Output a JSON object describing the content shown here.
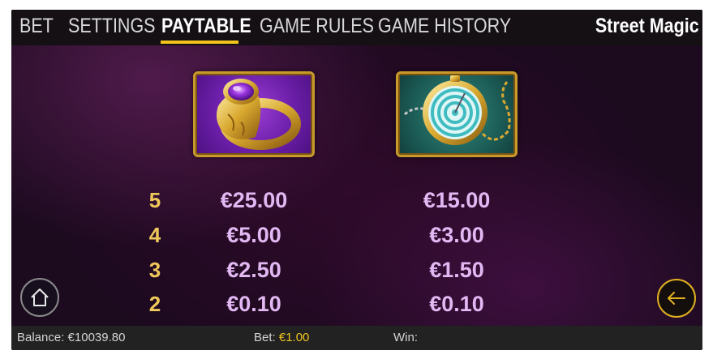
{
  "nav": {
    "tabs": [
      {
        "label": "BET",
        "active": false
      },
      {
        "label": "SETTINGS",
        "active": false
      },
      {
        "label": "PAYTABLE",
        "active": true
      },
      {
        "label": "GAME RULES",
        "active": false
      },
      {
        "label": "GAME HISTORY",
        "active": false
      }
    ],
    "game_title": "Street Magic",
    "accent_color": "#f2c41c"
  },
  "paytable": {
    "symbols": [
      {
        "name": "ring-symbol",
        "icon": "amethyst-ring"
      },
      {
        "name": "watch-symbol",
        "icon": "pocket-watch"
      }
    ],
    "rows": [
      {
        "count": "5",
        "values": [
          "€25.00",
          "€15.00"
        ]
      },
      {
        "count": "4",
        "values": [
          "€5.00",
          "€3.00"
        ]
      },
      {
        "count": "3",
        "values": [
          "€2.50",
          "€1.50"
        ]
      },
      {
        "count": "2",
        "values": [
          "€0.10",
          "€0.10"
        ]
      }
    ]
  },
  "buttons": {
    "home_icon": "home-icon",
    "back_icon": "arrow-left-icon"
  },
  "status": {
    "balance_label": "Balance:",
    "balance_value": "€10039.80",
    "bet_label": "Bet:",
    "bet_value": "€1.00",
    "win_label": "Win:",
    "win_value": ""
  }
}
